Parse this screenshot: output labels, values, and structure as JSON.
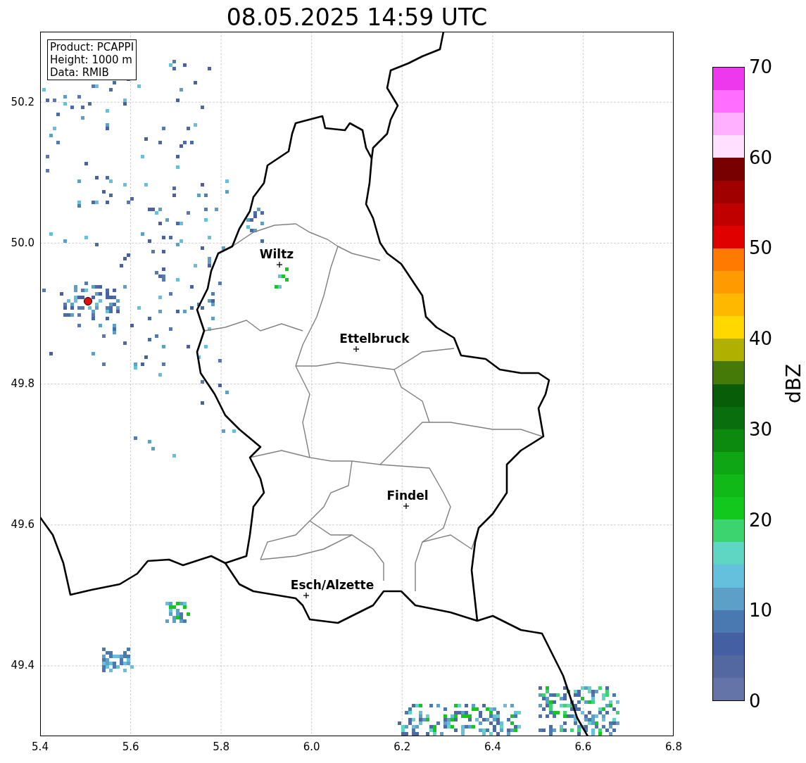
{
  "title": "08.05.2025 14:59 UTC",
  "info_box": [
    "Product: PCAPPI",
    "Height: 1000 m",
    "Data: RMIB"
  ],
  "cities": [
    {
      "name": "Wiltz"
    },
    {
      "name": "Ettelbruck"
    },
    {
      "name": "Findel"
    },
    {
      "name": "Esch/Alzette"
    }
  ],
  "x_ticks": [
    "5.4",
    "5.6",
    "5.8",
    "6.0",
    "6.2",
    "6.4",
    "6.6",
    "6.8"
  ],
  "y_ticks": [
    "50.2",
    "50.0",
    "49.8",
    "49.6",
    "49.4"
  ],
  "colorbar": {
    "label": "dBZ",
    "ticks": [
      "70",
      "60",
      "50",
      "40",
      "30",
      "20",
      "10",
      "0"
    ],
    "segments": [
      {
        "color": "#ee38ee"
      },
      {
        "color": "#ff6eff"
      },
      {
        "color": "#ffb0ff"
      },
      {
        "color": "#ffe0ff"
      },
      {
        "color": "#780000"
      },
      {
        "color": "#a00000"
      },
      {
        "color": "#c00000"
      },
      {
        "color": "#e00000"
      },
      {
        "color": "#ff7a00"
      },
      {
        "color": "#ff9a00"
      },
      {
        "color": "#ffb800"
      },
      {
        "color": "#ffd800"
      },
      {
        "color": "#b0b000"
      },
      {
        "color": "#467a08"
      },
      {
        "color": "#085e08"
      },
      {
        "color": "#086e0e"
      },
      {
        "color": "#0c8a10"
      },
      {
        "color": "#0ea614"
      },
      {
        "color": "#10b818"
      },
      {
        "color": "#12c81c"
      },
      {
        "color": "#3cd46e"
      },
      {
        "color": "#5fd6c4"
      },
      {
        "color": "#64c0dc"
      },
      {
        "color": "#5ca0c8"
      },
      {
        "color": "#4a78b0"
      },
      {
        "color": "#4460a2"
      },
      {
        "color": "#5468a0"
      },
      {
        "color": "#6474a8"
      }
    ]
  }
}
